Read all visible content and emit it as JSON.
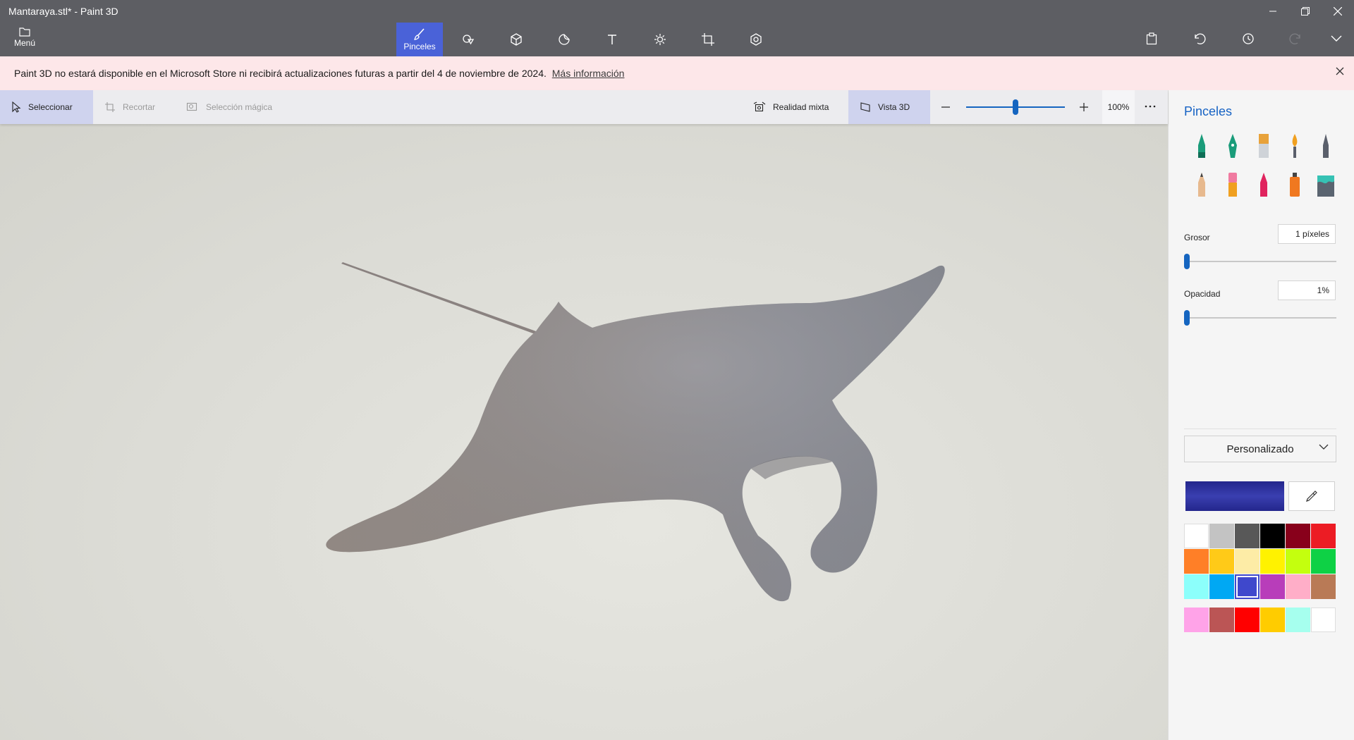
{
  "window": {
    "title": "Mantaraya.stl* - Paint 3D"
  },
  "menu": {
    "label": "Menú"
  },
  "tools": [
    {
      "name": "brushes",
      "label": "Pinceles",
      "icon": "brush-icon",
      "active": true
    },
    {
      "name": "2d-shapes",
      "label": "",
      "icon": "2d-shapes-icon"
    },
    {
      "name": "3d-shapes",
      "label": "",
      "icon": "3d-shapes-icon"
    },
    {
      "name": "stickers",
      "label": "",
      "icon": "stickers-icon"
    },
    {
      "name": "text",
      "label": "",
      "icon": "text-icon"
    },
    {
      "name": "effects",
      "label": "",
      "icon": "effects-icon"
    },
    {
      "name": "canvas",
      "label": "",
      "icon": "canvas-icon"
    },
    {
      "name": "3d-library",
      "label": "",
      "icon": "3d-library-icon"
    }
  ],
  "banner": {
    "text": "Paint 3D no estará disponible en el Microsoft Store ni recibirá actualizaciones futuras a partir del 4 de noviembre de 2024.",
    "link": "Más información"
  },
  "subtoolbar": {
    "select": "Seleccionar",
    "crop": "Recortar",
    "magic_select": "Selección mágica",
    "mixed_reality": "Realidad mixta",
    "view3d": "Vista 3D",
    "zoom": "100%",
    "zoom_level": 0.5
  },
  "panel": {
    "title": "Pinceles",
    "thickness_label": "Grosor",
    "thickness_value": "1 píxeles",
    "thickness_level": 0.0,
    "opacity_label": "Opacidad",
    "opacity_value": "1%",
    "opacity_level": 0.0,
    "color_mode": "Personalizado",
    "current_color": "#23268c",
    "palette": [
      "#ffffff",
      "#c3c3c3",
      "#585858",
      "#000000",
      "#88001b",
      "#ec1c24",
      "#ff7f27",
      "#ffca18",
      "#fdeca6",
      "#fff200",
      "#c4ff0e",
      "#0ed145",
      "#8cfffb",
      "#00a8f3",
      "#3f48cc",
      "#b83dba",
      "#ffaec8",
      "#b97a56"
    ],
    "custom_colors": [
      "#ffa3e8",
      "#bb5555",
      "#ff0000",
      "#ffcc00",
      "#a6ffee",
      "#ffffff"
    ],
    "selected_palette_index": 14
  }
}
